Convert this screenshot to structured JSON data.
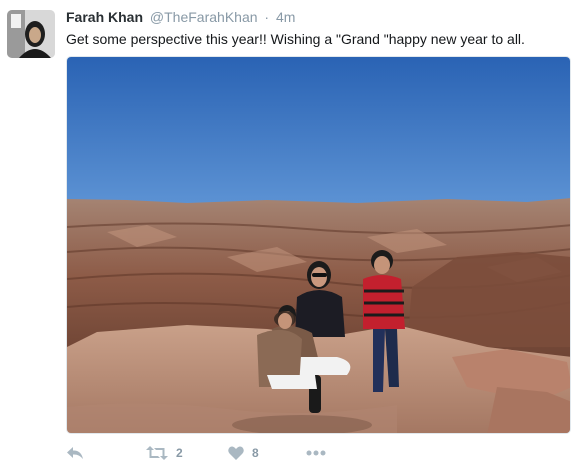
{
  "tweet": {
    "author_name": "Farah Khan",
    "handle": "@TheFarahKhan",
    "separator": "·",
    "time": "4m",
    "text": "Get some perspective this year!! Wishing a \"Grand \"happy new year to all.",
    "retweet_count": "2",
    "like_count": "8"
  },
  "icons": {
    "reply": "reply-icon",
    "retweet": "retweet-icon",
    "like": "heart-icon",
    "more": "more-dots-icon"
  },
  "colors": {
    "icon_gray": "#aab8c2",
    "handle_gray": "#8899a6",
    "text": "#14171a"
  }
}
